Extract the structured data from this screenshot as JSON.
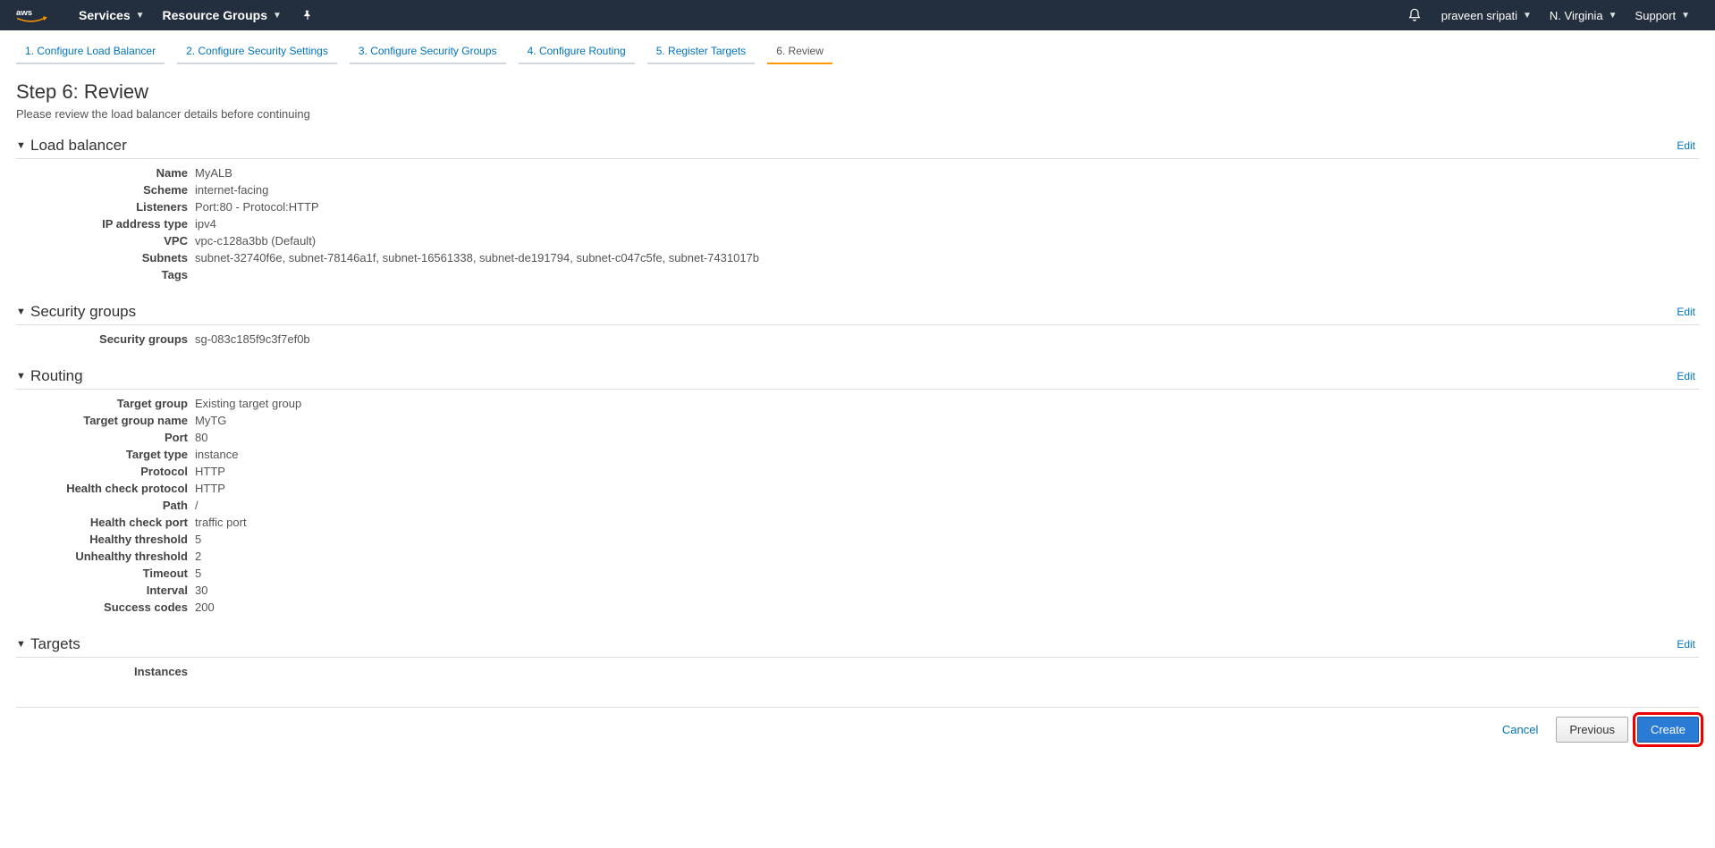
{
  "topnav": {
    "services": "Services",
    "resource_groups": "Resource Groups",
    "user": "praveen sripati",
    "region": "N. Virginia",
    "support": "Support"
  },
  "wizard": {
    "tabs": [
      "1. Configure Load Balancer",
      "2. Configure Security Settings",
      "3. Configure Security Groups",
      "4. Configure Routing",
      "5. Register Targets",
      "6. Review"
    ]
  },
  "page": {
    "title": "Step 6: Review",
    "subtitle": "Please review the load balancer details before continuing"
  },
  "edit_label": "Edit",
  "sections": {
    "lb": {
      "title": "Load balancer",
      "name_k": "Name",
      "name_v": "MyALB",
      "scheme_k": "Scheme",
      "scheme_v": "internet-facing",
      "listeners_k": "Listeners",
      "listeners_v": "Port:80 - Protocol:HTTP",
      "ip_k": "IP address type",
      "ip_v": "ipv4",
      "vpc_k": "VPC",
      "vpc_v": "vpc-c128a3bb (Default)",
      "subnets_k": "Subnets",
      "subnets_v": "subnet-32740f6e, subnet-78146a1f, subnet-16561338, subnet-de191794, subnet-c047c5fe, subnet-7431017b",
      "tags_k": "Tags",
      "tags_v": ""
    },
    "sg": {
      "title": "Security groups",
      "sg_k": "Security groups",
      "sg_v": "sg-083c185f9c3f7ef0b"
    },
    "routing": {
      "title": "Routing",
      "tg_k": "Target group",
      "tg_v": "Existing target group",
      "tgn_k": "Target group name",
      "tgn_v": "MyTG",
      "port_k": "Port",
      "port_v": "80",
      "tt_k": "Target type",
      "tt_v": "instance",
      "proto_k": "Protocol",
      "proto_v": "HTTP",
      "hcp_k": "Health check protocol",
      "hcp_v": "HTTP",
      "path_k": "Path",
      "path_v": "/",
      "hcport_k": "Health check port",
      "hcport_v": "traffic port",
      "ht_k": "Healthy threshold",
      "ht_v": "5",
      "ut_k": "Unhealthy threshold",
      "ut_v": "2",
      "to_k": "Timeout",
      "to_v": "5",
      "int_k": "Interval",
      "int_v": "30",
      "sc_k": "Success codes",
      "sc_v": "200"
    },
    "targets": {
      "title": "Targets",
      "inst_k": "Instances",
      "inst_v": ""
    }
  },
  "footer": {
    "cancel": "Cancel",
    "previous": "Previous",
    "create": "Create"
  }
}
